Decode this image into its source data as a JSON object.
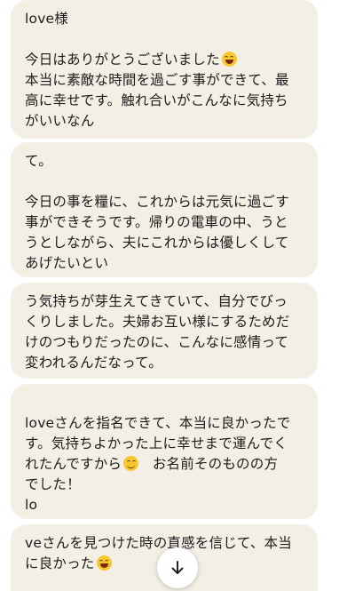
{
  "messages": [
    {
      "lines": [
        "love様",
        "",
        "今日はありがとうございました",
        "本当に素敵な時間を過ごす事ができて、最",
        "高に幸せです。触れ合いがこんなに気持ち",
        "がいいなん"
      ],
      "emoji_after_line": 2,
      "emoji": "laughing-face"
    },
    {
      "lines": [
        "て。",
        "",
        "今日の事を糧に、これからは元気に過ごす",
        "事ができそうです。帰りの電車の中、うと",
        "うとしながら、夫にこれからは優しくして",
        "あげたいとい"
      ]
    },
    {
      "lines": [
        "う気持ちが芽生えてきていて、自分でびっ",
        "くりしました。夫婦お互い様にするためだ",
        "けのつもりだったのに、こんなに感情って",
        "変われるんだなって。"
      ]
    },
    {
      "lines": [
        "",
        "loveさんを指名できて、本当に良かったで",
        "す。気持ちよかった上に幸せまで運んでく",
        "れたんですから",
        "でした！",
        "lo"
      ],
      "emoji_after_line": 3,
      "emoji": "relieved-face",
      "line3_tail": "　お名前そのものの方"
    },
    {
      "lines": [
        "veさんを見つけた時の直感を信じて、本当",
        "に良かった"
      ],
      "emoji_after_line": 1,
      "emoji": "laughing-face"
    }
  ],
  "scroll_button": {
    "icon": "arrow-down-icon"
  }
}
